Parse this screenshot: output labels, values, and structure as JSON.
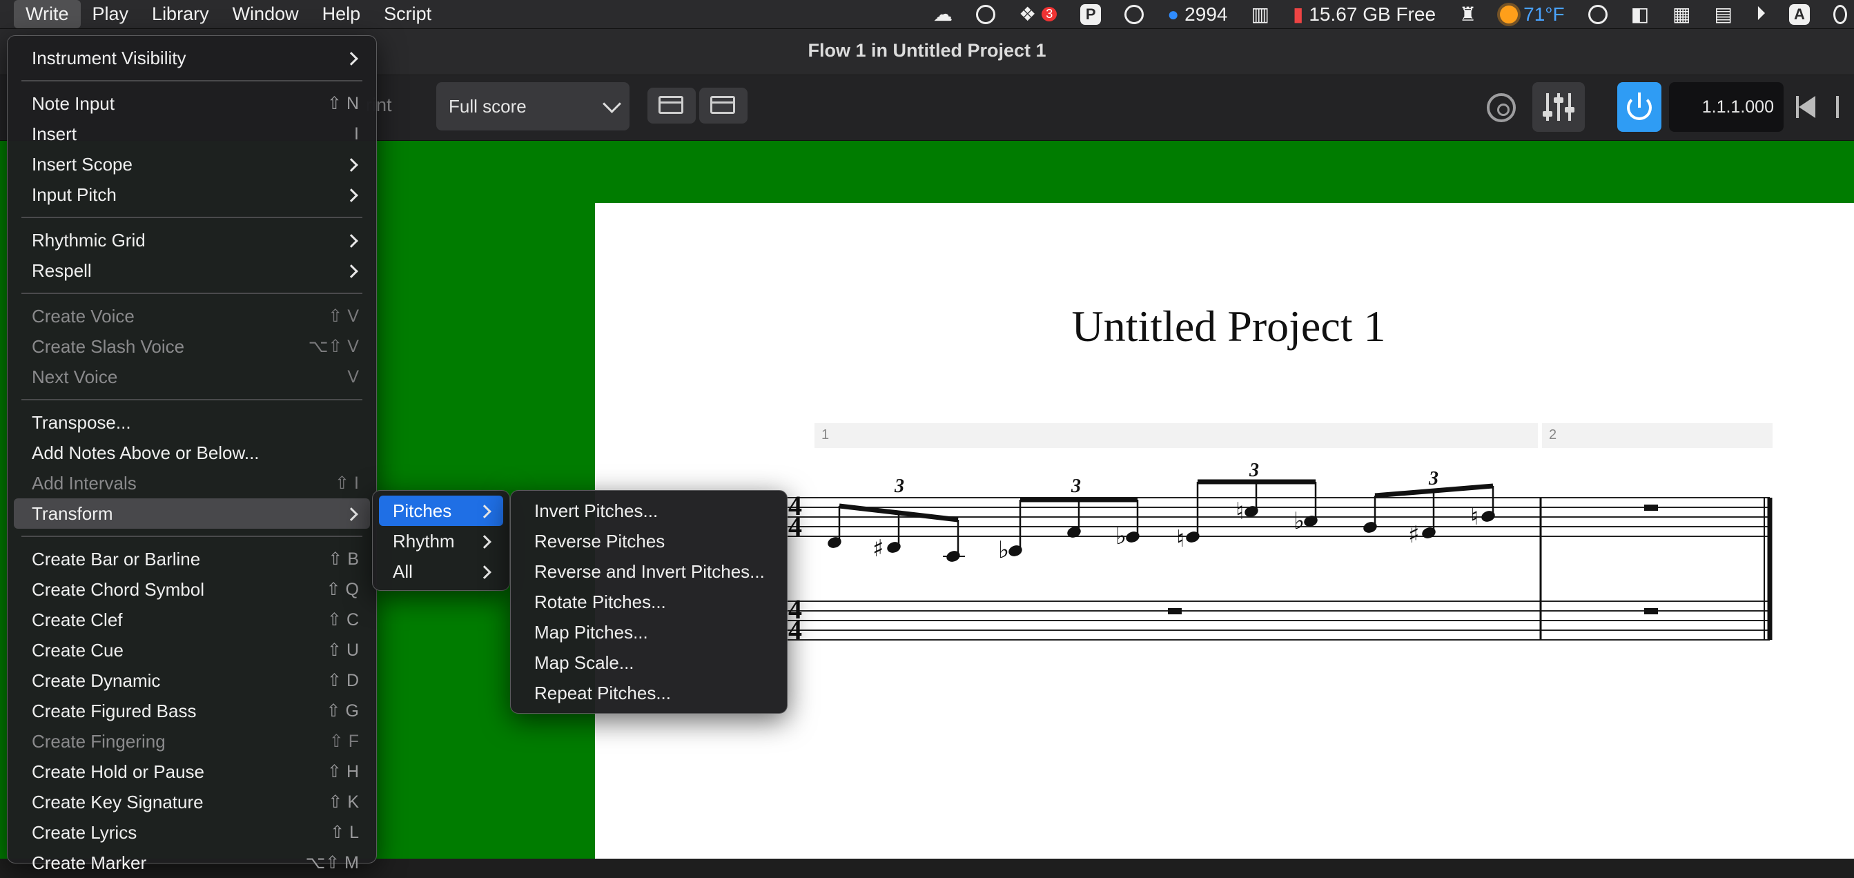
{
  "menubar": {
    "items": [
      "Write",
      "Play",
      "Library",
      "Window",
      "Help",
      "Script"
    ],
    "status": {
      "dropbox_badge": "3",
      "p_label": "P",
      "mail_count": "2994",
      "disk_free": "15.67 GB Free",
      "temperature": "71°F",
      "input_label": "A"
    }
  },
  "window": {
    "title": "Flow 1 in Untitled Project 1"
  },
  "toolbar": {
    "print_label": "rint",
    "layout_select_value": "Full score",
    "position": "1.1.1.000"
  },
  "score": {
    "title": "Untitled Project 1",
    "bar_numbers": [
      "1",
      "2"
    ],
    "tuplet_label": "3"
  },
  "write_menu": {
    "items": [
      {
        "label": "Instrument Visibility",
        "shortcut": "",
        "submenu": true
      },
      {
        "label": "Note Input",
        "shortcut": "⇧ N"
      },
      {
        "label": "Insert",
        "shortcut": "I"
      },
      {
        "label": "Insert Scope",
        "shortcut": "",
        "submenu": true
      },
      {
        "label": "Input Pitch",
        "shortcut": "",
        "submenu": true
      },
      {
        "label": "Rhythmic Grid",
        "shortcut": "",
        "submenu": true
      },
      {
        "label": "Respell",
        "shortcut": "",
        "submenu": true
      },
      {
        "label": "Create Voice",
        "shortcut": "⇧ V",
        "disabled": true
      },
      {
        "label": "Create Slash Voice",
        "shortcut": "⌥⇧ V",
        "disabled": true
      },
      {
        "label": "Next Voice",
        "shortcut": "V",
        "disabled": true
      },
      {
        "label": "Transpose...",
        "shortcut": ""
      },
      {
        "label": "Add Notes Above or Below...",
        "shortcut": ""
      },
      {
        "label": "Add Intervals",
        "shortcut": "⇧ I",
        "disabled": true
      },
      {
        "label": "Transform",
        "shortcut": "",
        "submenu": true
      },
      {
        "label": "Create Bar or Barline",
        "shortcut": "⇧ B"
      },
      {
        "label": "Create Chord Symbol",
        "shortcut": "⇧ Q"
      },
      {
        "label": "Create Clef",
        "shortcut": "⇧ C"
      },
      {
        "label": "Create Cue",
        "shortcut": "⇧ U"
      },
      {
        "label": "Create Dynamic",
        "shortcut": "⇧ D"
      },
      {
        "label": "Create Figured Bass",
        "shortcut": "⇧ G"
      },
      {
        "label": "Create Fingering",
        "shortcut": "⇧ F",
        "disabled": true
      },
      {
        "label": "Create Hold or Pause",
        "shortcut": "⇧ H"
      },
      {
        "label": "Create Key Signature",
        "shortcut": "⇧ K"
      },
      {
        "label": "Create Lyrics",
        "shortcut": "⇧ L"
      },
      {
        "label": "Create Marker",
        "shortcut": "⌥⇧ M"
      }
    ]
  },
  "transform_menu": {
    "items": [
      "Pitches",
      "Rhythm",
      "All"
    ]
  },
  "pitches_menu": {
    "items": [
      "Invert Pitches...",
      "Reverse Pitches",
      "Reverse and Invert Pitches...",
      "Rotate Pitches...",
      "Map Pitches...",
      "Map Scale...",
      "Repeat Pitches..."
    ]
  },
  "colors": {
    "accent": "#1f6fe5",
    "score_bg": "#007c00",
    "transport_active": "#2f9cf4"
  }
}
